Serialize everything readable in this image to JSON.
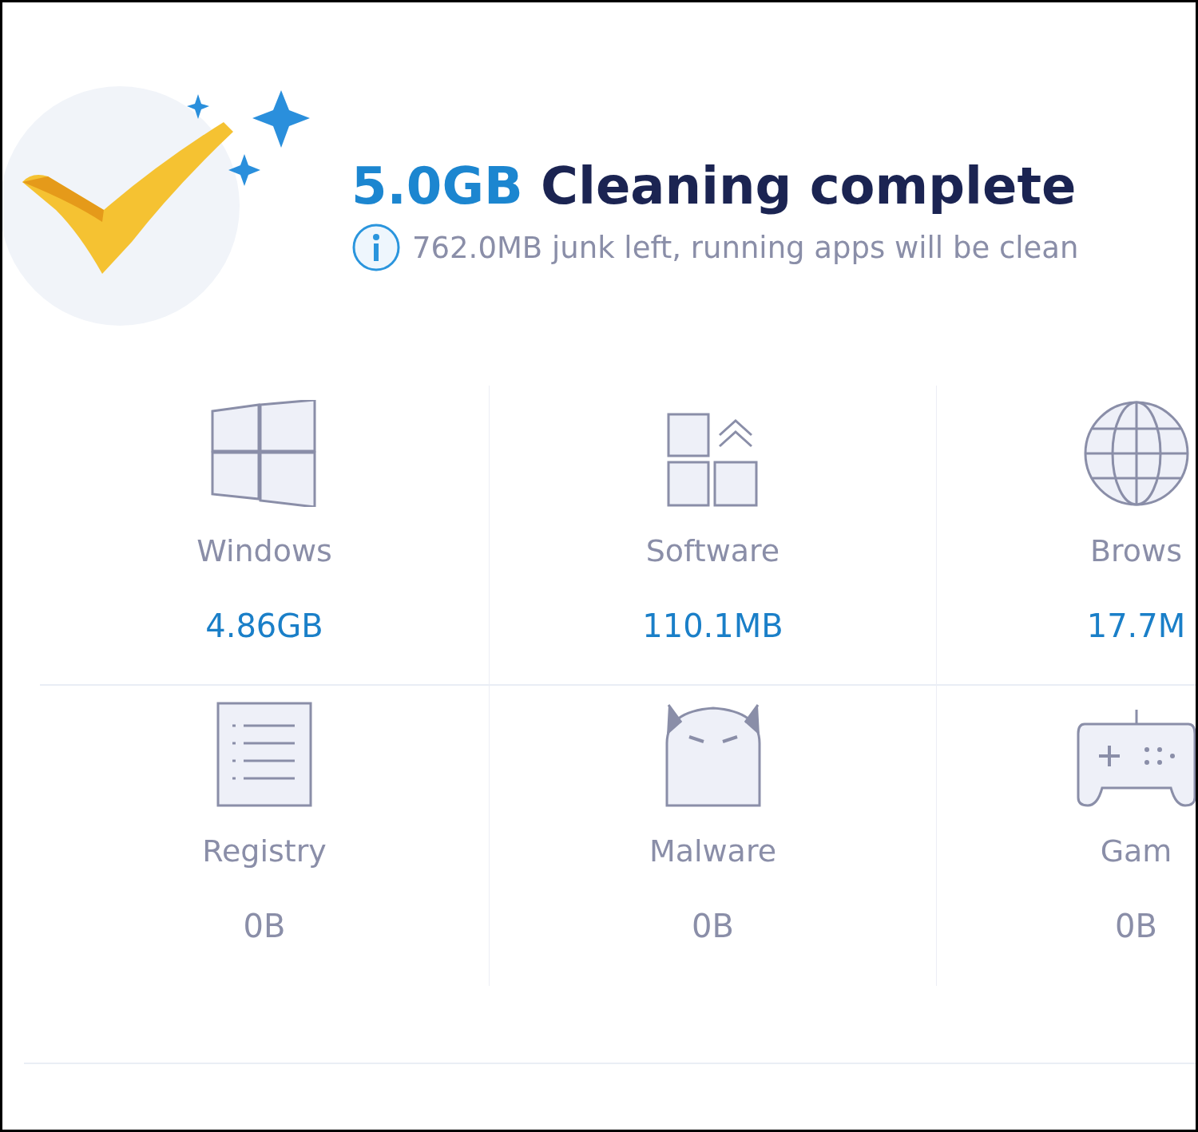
{
  "header": {
    "amount": "5.0GB",
    "title": "Cleaning complete",
    "note": "762.0MB junk left, running apps will be clean"
  },
  "categories": [
    {
      "kind": "windows",
      "label": "Windows",
      "size": "4.86GB",
      "highlighted": true
    },
    {
      "kind": "software",
      "label": "Software",
      "size": "110.1MB",
      "highlighted": true
    },
    {
      "kind": "browser",
      "label": "Brows",
      "size": "17.7M",
      "highlighted": true
    },
    {
      "kind": "registry",
      "label": "Registry",
      "size": "0B",
      "highlighted": false
    },
    {
      "kind": "malware",
      "label": "Malware",
      "size": "0B",
      "highlighted": false
    },
    {
      "kind": "games",
      "label": "Gam",
      "size": "0B",
      "highlighted": false
    }
  ]
}
